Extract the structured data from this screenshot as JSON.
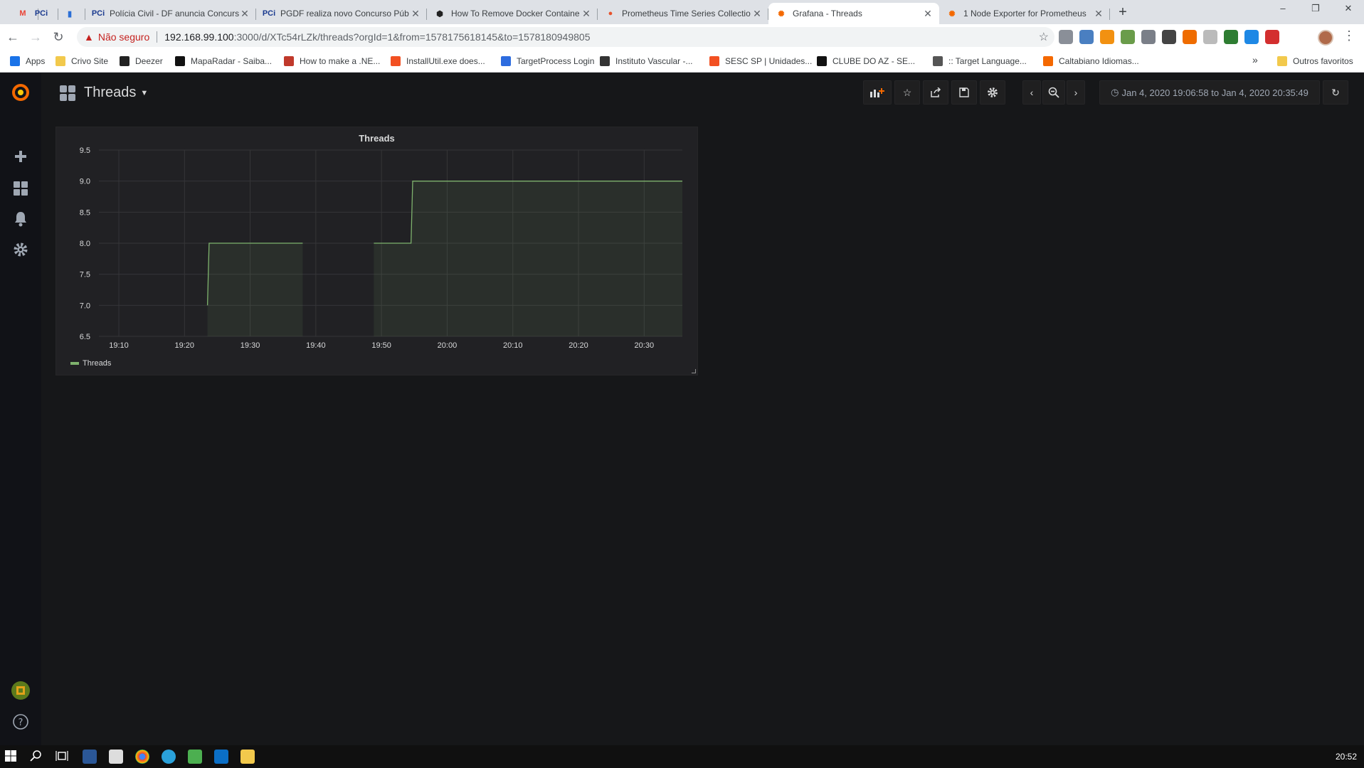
{
  "browser": {
    "tabs": [
      {
        "title": "",
        "favicon": "gmail",
        "color": "#ea4335",
        "glyph": "M"
      },
      {
        "title": "",
        "favicon": "pci",
        "color": "#1a3a8f",
        "glyph": "PCi"
      },
      {
        "title": "",
        "favicon": "chart",
        "color": "#2b6fd6",
        "glyph": "▮"
      },
      {
        "title": "Polícia Civil - DF anuncia Concurs",
        "favicon": "pci",
        "color": "#1a3a8f",
        "glyph": "PCi"
      },
      {
        "title": "PGDF realiza novo Concurso Púb",
        "favicon": "pci",
        "color": "#1a3a8f",
        "glyph": "PCi"
      },
      {
        "title": "How To Remove Docker Containe",
        "favicon": "hexagon",
        "color": "#222222",
        "glyph": "⬢"
      },
      {
        "title": "Prometheus Time Series Collectio",
        "favicon": "prometheus",
        "color": "#e6522c",
        "glyph": "●"
      },
      {
        "title": "Grafana - Threads",
        "favicon": "grafana",
        "color": "#f46800",
        "glyph": "✺",
        "active": true
      },
      {
        "title": "1 Node Exporter for Prometheus",
        "favicon": "grafana",
        "color": "#f46800",
        "glyph": "✺"
      }
    ],
    "new_tab_label": "+",
    "window_controls": [
      "–",
      "❐",
      "✕"
    ],
    "security_label": "Não seguro",
    "url_host": "192.168.99.100",
    "url_rest": ":3000/d/XTc54rLZk/threads?orgId=1&from=1578175618145&to=1578180949805",
    "bookmarks": [
      {
        "label": "Apps",
        "color": "#1a73e8"
      },
      {
        "label": "Crivo Site",
        "color": "#f2c94c"
      },
      {
        "label": "Deezer",
        "color": "#222222"
      },
      {
        "label": "MapaRadar - Saiba...",
        "color": "#111111"
      },
      {
        "label": "How to make a .NE...",
        "color": "#c0392b"
      },
      {
        "label": "InstallUtil.exe does...",
        "color": "#f25022"
      },
      {
        "label": "TargetProcess Login",
        "color": "#2d6cdf"
      },
      {
        "label": "Instituto Vascular -...",
        "color": "#333333"
      },
      {
        "label": "SESC SP | Unidades...",
        "color": "#f25022"
      },
      {
        "label": "CLUBE DO AZ - SE...",
        "color": "#111111"
      },
      {
        "label": ":: Target Language...",
        "color": "#555555"
      },
      {
        "label": "Caltabiano Idiomas...",
        "color": "#f46800"
      }
    ],
    "more_bookmarks": "»",
    "other_bookmarks": "Outros favoritos"
  },
  "grafana": {
    "dashboard_title": "Threads",
    "time_range": "Jan 4, 2020 19:06:58 to Jan 4, 2020 20:35:49",
    "panel": {
      "title": "Threads",
      "legend": "Threads"
    }
  },
  "chart_data": {
    "type": "line",
    "title": "Threads",
    "series": [
      {
        "name": "Threads",
        "color": "#7eb26d",
        "segments": [
          [
            [
              "19:23:30",
              7.0
            ],
            [
              "19:23:45",
              8.0
            ],
            [
              "19:38:00",
              8.0
            ]
          ],
          [
            [
              "19:48:50",
              8.0
            ],
            [
              "19:54:30",
              8.0
            ],
            [
              "19:54:45",
              9.0
            ],
            [
              "20:35:49",
              9.0
            ]
          ]
        ]
      }
    ],
    "x_ticks": [
      "19:10",
      "19:20",
      "19:30",
      "19:40",
      "19:50",
      "20:00",
      "20:10",
      "20:20",
      "20:30"
    ],
    "y_ticks": [
      "6.5",
      "7.0",
      "7.5",
      "8.0",
      "8.5",
      "9.0",
      "9.5"
    ],
    "xlim": [
      "19:06:58",
      "20:35:49"
    ],
    "ylim": [
      6.5,
      9.5
    ],
    "fill": true,
    "grid": true,
    "legend_position": "bottom-left"
  },
  "taskbar": {
    "clock": "20:52"
  }
}
